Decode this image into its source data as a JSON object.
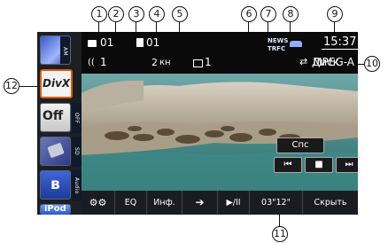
{
  "callouts": [
    "1",
    "2",
    "3",
    "4",
    "5",
    "6",
    "7",
    "8",
    "9",
    "10",
    "11",
    "12"
  ],
  "topbar": {
    "folder_number": "01",
    "track_number": "01",
    "audio_channel": "1",
    "angle": "1",
    "subtitle_number": "1",
    "chapter_label": "2",
    "chapter_unit": "кн",
    "news_label": "NEWS",
    "trfc_label": "TRFC",
    "repeat_label": "Диск",
    "clock": "15:37",
    "format": "MPEG-A"
  },
  "sidebar": {
    "am_label": "AM",
    "divx_label": "DivX",
    "off_label": "Off",
    "off_side": "OFF",
    "sd_label": "SD",
    "audio_label": "Audio",
    "ipod_label": "iPod"
  },
  "controls": {
    "cnc_label": "Спс",
    "prev_glyph": "⏮",
    "stop_glyph": "■",
    "next_glyph": "⏭"
  },
  "bottombar": {
    "settings_icon": "settings-icon",
    "eq_label": "EQ",
    "info_label": "Инф.",
    "arrow_glyph": "➔",
    "play_pause_label": "▶/II",
    "elapsed_time": "03\"12\"",
    "hide_label": "Скрыть"
  }
}
